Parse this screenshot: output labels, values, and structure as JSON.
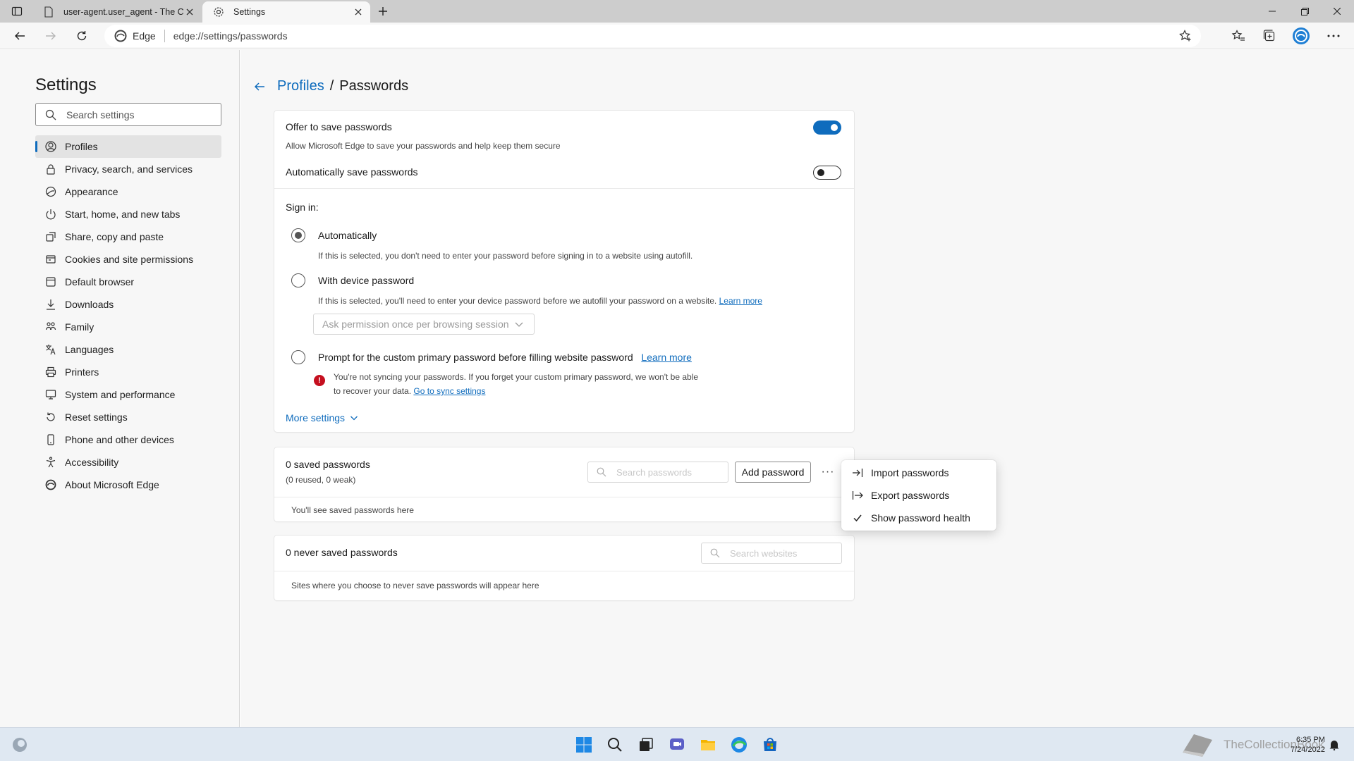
{
  "browser": {
    "tabs": [
      {
        "title": "user-agent.user_agent - The Coll",
        "active": false
      },
      {
        "title": "Settings",
        "active": true
      }
    ],
    "address": {
      "site_label": "Edge",
      "url": "edge://settings/passwords"
    }
  },
  "sidebar": {
    "title": "Settings",
    "search_placeholder": "Search settings",
    "items": [
      {
        "label": "Profiles",
        "icon": "profile-icon"
      },
      {
        "label": "Privacy, search, and services",
        "icon": "lock-icon"
      },
      {
        "label": "Appearance",
        "icon": "appearance-icon"
      },
      {
        "label": "Start, home, and new tabs",
        "icon": "power-icon"
      },
      {
        "label": "Share, copy and paste",
        "icon": "share-icon"
      },
      {
        "label": "Cookies and site permissions",
        "icon": "cookies-icon"
      },
      {
        "label": "Default browser",
        "icon": "browser-icon"
      },
      {
        "label": "Downloads",
        "icon": "download-icon"
      },
      {
        "label": "Family",
        "icon": "family-icon"
      },
      {
        "label": "Languages",
        "icon": "languages-icon"
      },
      {
        "label": "Printers",
        "icon": "printer-icon"
      },
      {
        "label": "System and performance",
        "icon": "computer-icon"
      },
      {
        "label": "Reset settings",
        "icon": "reset-icon"
      },
      {
        "label": "Phone and other devices",
        "icon": "phone-icon"
      },
      {
        "label": "Accessibility",
        "icon": "accessibility-icon"
      },
      {
        "label": "About Microsoft Edge",
        "icon": "edge-icon"
      }
    ]
  },
  "breadcrumb": {
    "parent": "Profiles",
    "separator": "/",
    "current": "Passwords"
  },
  "settings": {
    "offer_save": {
      "label": "Offer to save passwords",
      "sub": "Allow Microsoft Edge to save your passwords and help keep them secure",
      "on": true
    },
    "auto_save": {
      "label": "Automatically save passwords",
      "on": false
    },
    "signin": {
      "heading": "Sign in:",
      "opt_auto": {
        "label": "Automatically",
        "desc": "If this is selected, you don't need to enter your password before signing in to a website using autofill."
      },
      "opt_device": {
        "label": "With device password",
        "desc": "If this is selected, you'll need to enter your device password before we autofill your password on a website.",
        "learn_more": "Learn more",
        "dropdown": "Ask permission once per browsing session"
      },
      "opt_primary": {
        "label": "Prompt for the custom primary password before filling website password",
        "learn_more": "Learn more",
        "warning_line1": "You're not syncing your passwords. If you forget your custom primary password, we won't be able",
        "warning_line2": "to recover your data.",
        "sync_link": "Go to sync settings"
      }
    },
    "more_settings": "More settings"
  },
  "saved": {
    "title": "0 saved passwords",
    "sub": "(0 reused, 0 weak)",
    "search_placeholder": "Search passwords",
    "add_button": "Add password",
    "more": "···",
    "empty": "You'll see saved passwords here"
  },
  "never_saved": {
    "title": "0 never saved passwords",
    "search_placeholder": "Search websites",
    "empty": "Sites where you choose to never save passwords will appear here"
  },
  "context_menu": {
    "items": [
      {
        "label": "Import passwords",
        "icon": "import-icon"
      },
      {
        "label": "Export passwords",
        "icon": "export-icon"
      },
      {
        "label": "Show password health",
        "icon": "checkmark-icon"
      }
    ]
  },
  "taskbar": {
    "time": "6:35 PM",
    "date": "7/24/2022",
    "watermark": "TheCollectionBook"
  },
  "colors": {
    "accent": "#0f6cbd",
    "error": "#c50f1f"
  }
}
